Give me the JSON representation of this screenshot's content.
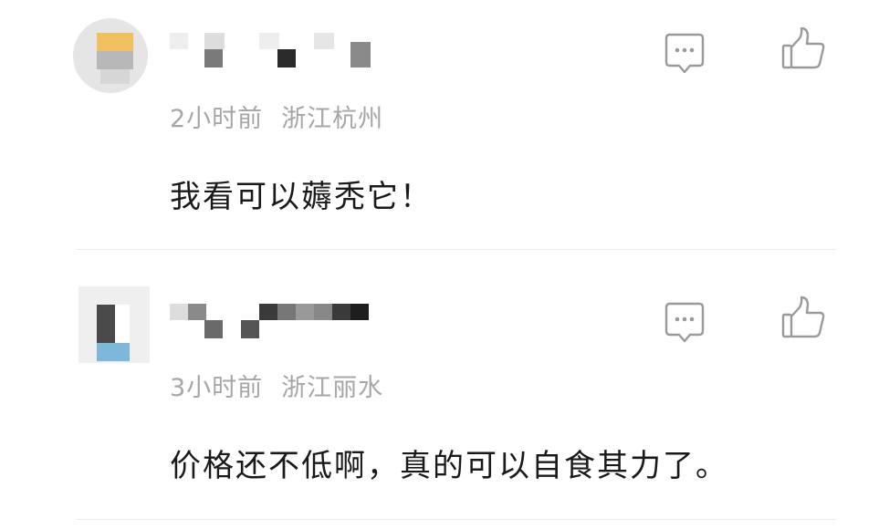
{
  "comments": [
    {
      "avatar_icon": "avatar-blurred",
      "username": "",
      "time": "2小时前",
      "location": "浙江杭州",
      "text": "我看可以薅秃它！",
      "reply_icon": "comment-bubble-icon",
      "like_icon": "thumbs-up-icon"
    },
    {
      "avatar_icon": "avatar-blurred",
      "username": "",
      "time": "3小时前",
      "location": "浙江丽水",
      "text": "价格还不低啊，真的可以自食其力了。",
      "reply_icon": "comment-bubble-icon",
      "like_icon": "thumbs-up-icon"
    }
  ],
  "colors": {
    "meta_text": "#a6a6a6",
    "body_text": "#1a1a1a",
    "icon_stroke": "#9a9a9a",
    "divider": "#ececec"
  }
}
